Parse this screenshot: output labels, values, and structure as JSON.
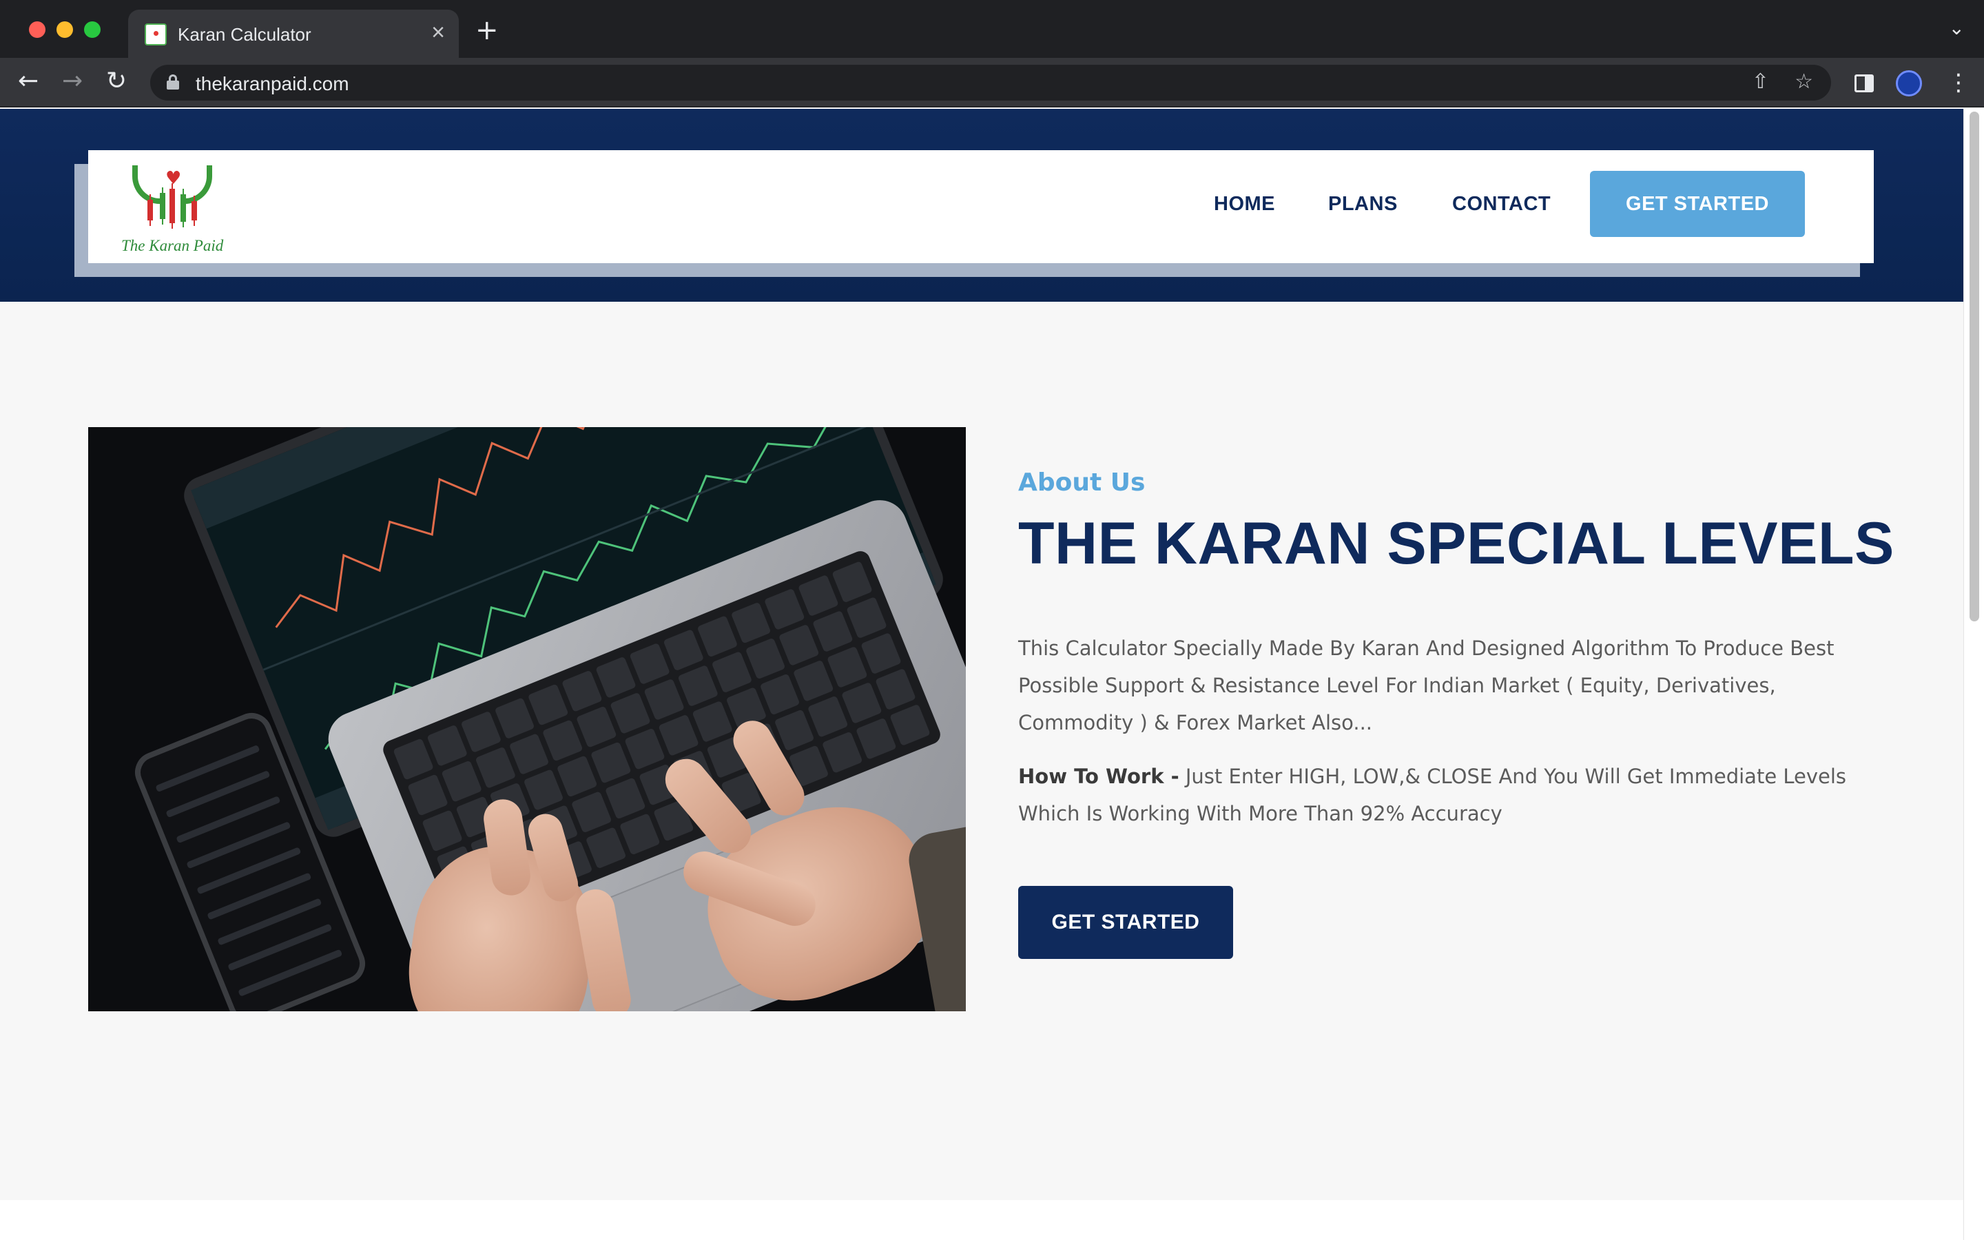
{
  "browser": {
    "tab_title": "Karan Calculator",
    "tab_close": "×",
    "new_tab": "+",
    "tab_list": "⌄",
    "url": "thekaranpaid.com",
    "icons": {
      "back": "←",
      "forward": "→",
      "reload": "↻",
      "share": "⇧",
      "star": "☆",
      "menu": "⋮"
    }
  },
  "header": {
    "logo_text": "The Karan Paid",
    "nav": [
      {
        "label": "HOME"
      },
      {
        "label": "PLANS"
      },
      {
        "label": "CONTACT"
      }
    ],
    "cta_label": "GET STARTED",
    "colors": {
      "header_bg": "#0f2a5c",
      "cta_bg": "#5aa7dc"
    }
  },
  "about": {
    "kicker": "About Us",
    "headline": "THE KARAN SPECIAL LEVELS",
    "description": "This Calculator Specially Made By Karan And Designed Algorithm To Produce Best Possible Support & Resistance Level For Indian Market ( Equity, Derivatives, Commodity ) & Forex Market Also...",
    "howto_label": "How To Work -",
    "howto_text": " Just Enter HIGH, LOW,& CLOSE And You Will Get Immediate Levels Which Is Working With More Than 92% Accuracy",
    "cta_label": "GET STARTED",
    "image_subject": "laptop-trading-charts-photo",
    "colors": {
      "kicker": "#5aa7dc",
      "headline": "#0f2a5c",
      "cta_bg": "#0f2a5c"
    }
  }
}
